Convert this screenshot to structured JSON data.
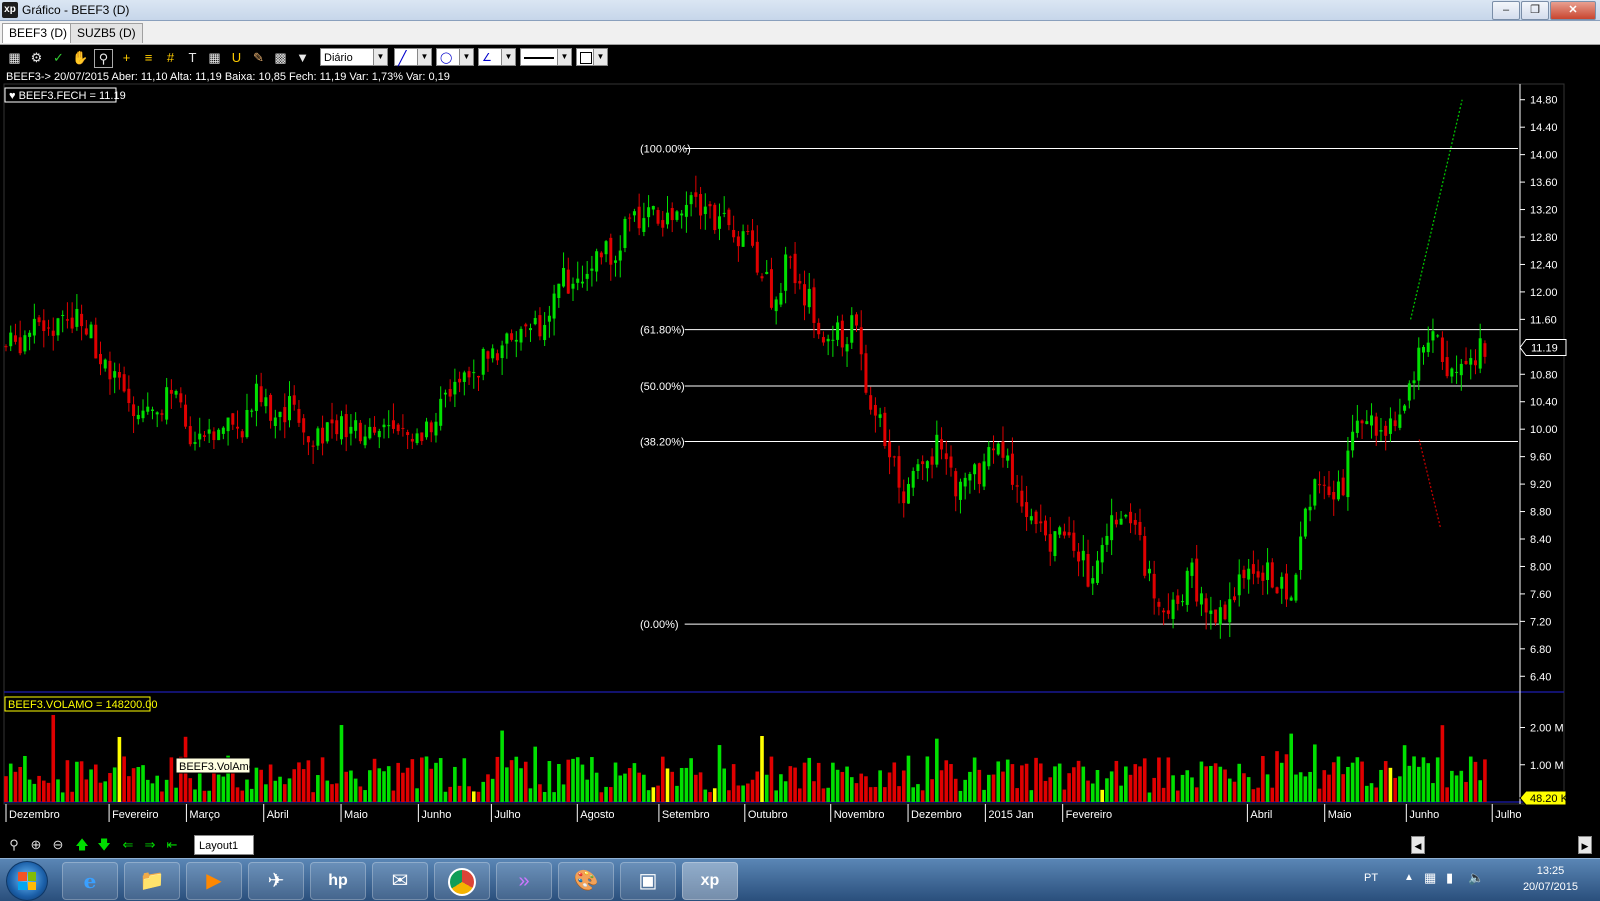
{
  "window": {
    "title": "Gráfico - BEEF3 (D)",
    "logo": "xp"
  },
  "tabs": [
    {
      "label": "BEEF3 (D)",
      "active": true
    },
    {
      "label": "SUZB5 (D)",
      "active": false
    }
  ],
  "toolbar": {
    "period": "Diário"
  },
  "info_line": "BEEF3-> 20/07/2015 Aber: 11,10 Alta: 11,19 Baixa: 10,85 Fech: 11,19 Var: 1,73% Var: 0,19",
  "status": {
    "layout_tab": "Layout1"
  },
  "taskbar": {
    "language": "PT",
    "time": "13:25",
    "date": "20/07/2015"
  },
  "colors": {
    "up": "#00e000",
    "down": "#e00000",
    "axis_text": "#ffffff",
    "fib_line": "#ffffff",
    "volume_highlight": "#ffff00",
    "divider": "#1c1cb0"
  },
  "chart_data": [
    {
      "type": "candlestick",
      "title": "BEEF3.FECH = 11.19",
      "current_value": "11.19",
      "ylim": [
        6.2,
        15.0
      ],
      "y_ticks": [
        "14.80",
        "14.40",
        "14.00",
        "13.60",
        "13.20",
        "12.80",
        "12.40",
        "12.00",
        "11.60",
        "11.20",
        "10.80",
        "10.40",
        "10.00",
        "9.60",
        "9.20",
        "8.80",
        "8.40",
        "8.00",
        "7.60",
        "7.20",
        "6.80",
        "6.40"
      ],
      "fibonacci": [
        {
          "label": "(100.00%)",
          "value": 14.09
        },
        {
          "label": "(61.80%)",
          "value": 11.45
        },
        {
          "label": "(50.00%)",
          "value": 10.63
        },
        {
          "label": "(38.20%)",
          "value": 9.82
        },
        {
          "label": "(0.00%)",
          "value": 7.16
        }
      ],
      "projection_lines": [
        {
          "color": "#00c000",
          "from": {
            "month_index": 16.35,
            "value": 11.6
          },
          "to": {
            "month_index": 16.95,
            "value": 14.8
          }
        },
        {
          "color": "#c00000",
          "from": {
            "month_index": 16.45,
            "value": 9.85
          },
          "to": {
            "month_index": 16.7,
            "value": 8.55
          }
        }
      ],
      "close_path": [
        [
          0,
          11.2
        ],
        [
          0.3,
          11.4
        ],
        [
          0.6,
          11.55
        ],
        [
          0.9,
          11.7
        ],
        [
          1.15,
          10.85
        ],
        [
          1.4,
          10.45
        ],
        [
          1.7,
          10.25
        ],
        [
          1.95,
          10.55
        ],
        [
          2.1,
          9.9
        ],
        [
          2.3,
          9.7
        ],
        [
          2.5,
          9.95
        ],
        [
          2.75,
          10.1
        ],
        [
          2.9,
          10.55
        ],
        [
          3.05,
          10.25
        ],
        [
          3.3,
          10.3
        ],
        [
          3.55,
          9.95
        ],
        [
          3.8,
          10.05
        ],
        [
          4.05,
          9.9
        ],
        [
          4.25,
          10.0
        ],
        [
          4.5,
          9.95
        ],
        [
          4.75,
          9.75
        ],
        [
          5.0,
          10.25
        ],
        [
          5.2,
          10.6
        ],
        [
          5.5,
          10.9
        ],
        [
          5.75,
          11.2
        ],
        [
          5.95,
          11.45
        ],
        [
          6.25,
          11.4
        ],
        [
          6.45,
          12.1
        ],
        [
          6.75,
          12.4
        ],
        [
          7.05,
          12.6
        ],
        [
          7.3,
          13.05
        ],
        [
          7.55,
          13.1
        ],
        [
          7.75,
          13.05
        ],
        [
          7.95,
          13.5
        ],
        [
          8.15,
          13.25
        ],
        [
          8.4,
          12.9
        ],
        [
          8.7,
          12.6
        ],
        [
          8.85,
          12.2
        ],
        [
          9.0,
          11.6
        ],
        [
          9.1,
          12.6
        ],
        [
          9.3,
          12.0
        ],
        [
          9.5,
          11.3
        ],
        [
          9.75,
          11.35
        ],
        [
          9.9,
          11.5
        ],
        [
          10.05,
          10.3
        ],
        [
          10.25,
          9.9
        ],
        [
          10.45,
          9.1
        ],
        [
          10.65,
          9.6
        ],
        [
          10.9,
          9.75
        ],
        [
          11.1,
          9.1
        ],
        [
          11.3,
          9.3
        ],
        [
          11.55,
          9.75
        ],
        [
          11.75,
          9.1
        ],
        [
          11.95,
          8.75
        ],
        [
          12.15,
          8.35
        ],
        [
          12.4,
          8.4
        ],
        [
          12.6,
          7.9
        ],
        [
          12.8,
          8.5
        ],
        [
          13.0,
          8.95
        ],
        [
          13.15,
          8.55
        ],
        [
          13.35,
          7.65
        ],
        [
          13.55,
          7.5
        ],
        [
          13.8,
          7.85
        ],
        [
          14.0,
          7.35
        ],
        [
          14.15,
          7.3
        ],
        [
          14.35,
          7.75
        ],
        [
          14.6,
          8.05
        ],
        [
          14.8,
          7.75
        ],
        [
          15.0,
          7.6
        ],
        [
          15.1,
          8.6
        ],
        [
          15.3,
          9.45
        ],
        [
          15.45,
          8.95
        ],
        [
          15.6,
          9.35
        ],
        [
          15.75,
          10.2
        ],
        [
          15.95,
          10.0
        ],
        [
          16.1,
          10.1
        ],
        [
          16.3,
          10.5
        ],
        [
          16.45,
          11.05
        ],
        [
          16.65,
          11.4
        ],
        [
          16.8,
          10.7
        ],
        [
          17.0,
          11.0
        ],
        [
          17.15,
          11.1
        ],
        [
          17.25,
          11.19
        ]
      ]
    },
    {
      "type": "bar",
      "title": "BEEF3.VOLAMO = 148200.00",
      "tooltip": "BEEF3.VolAmo",
      "current_value": "48.20 K",
      "ylim": [
        0,
        2.9
      ],
      "y_ticks": [
        "2.00 M",
        "1.00 M"
      ],
      "unit": "M"
    }
  ],
  "x_axis": {
    "months": [
      {
        "label": "Dezembro",
        "index": 0
      },
      {
        "label": "Fevereiro",
        "index": 1.2
      },
      {
        "label": "Março",
        "index": 2.1
      },
      {
        "label": "Abril",
        "index": 3.0
      },
      {
        "label": "Maio",
        "index": 3.9
      },
      {
        "label": "Junho",
        "index": 4.8
      },
      {
        "label": "Julho",
        "index": 5.65
      },
      {
        "label": "Agosto",
        "index": 6.65
      },
      {
        "label": "Setembro",
        "index": 7.6
      },
      {
        "label": "Outubro",
        "index": 8.6
      },
      {
        "label": "Novembro",
        "index": 9.6
      },
      {
        "label": "Dezembro",
        "index": 10.5
      },
      {
        "label": "2015 Jan",
        "index": 11.4
      },
      {
        "label": "Fevereiro",
        "index": 12.3
      },
      {
        "label": "Abril",
        "index": 14.45
      },
      {
        "label": "Maio",
        "index": 15.35
      },
      {
        "label": "Junho",
        "index": 16.3
      },
      {
        "label": "Julho",
        "index": 17.3
      }
    ],
    "range": [
      0,
      17.6
    ]
  }
}
